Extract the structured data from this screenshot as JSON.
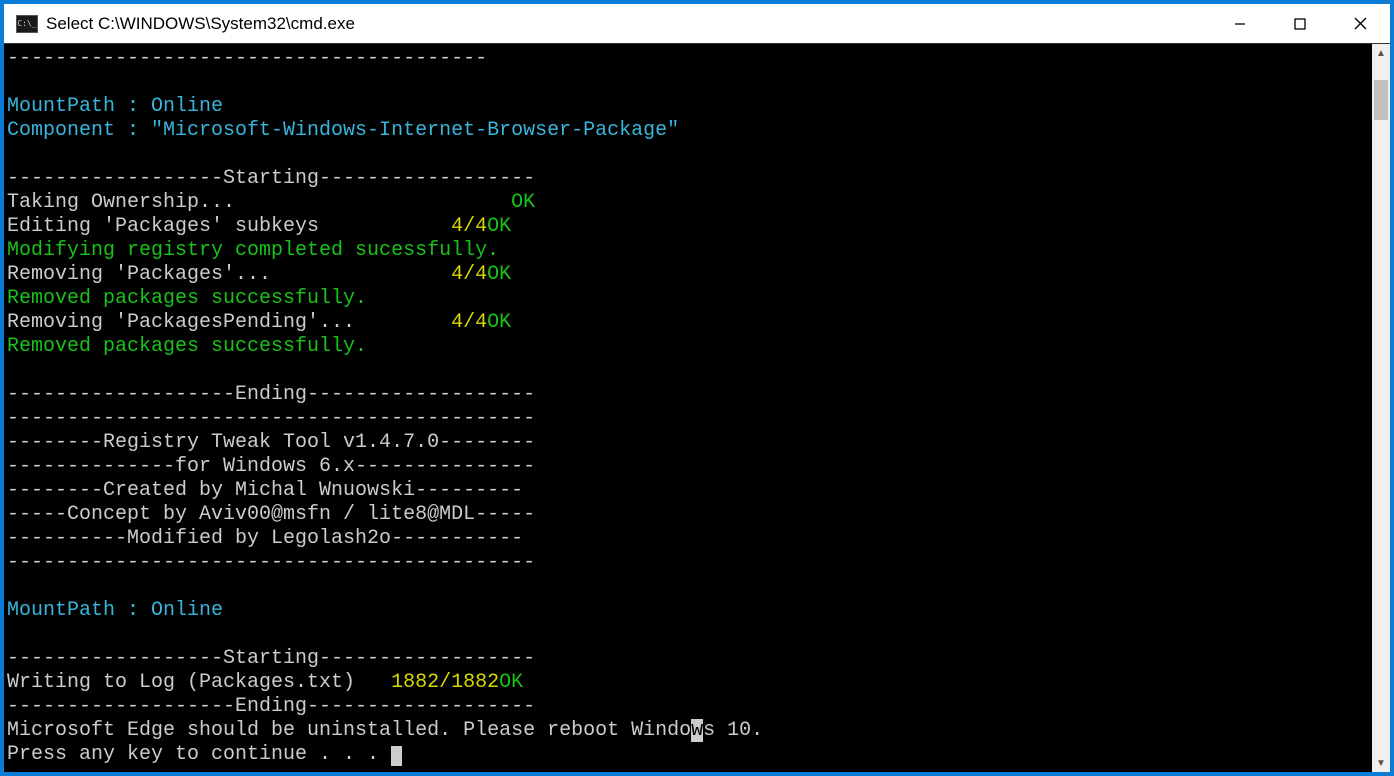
{
  "window": {
    "title": "Select C:\\WINDOWS\\System32\\cmd.exe",
    "icon_label": "C:\\_"
  },
  "lines": [
    [
      {
        "cls": "white",
        "txt": "----------------------------------------"
      }
    ],
    [
      {
        "cls": "white",
        "txt": ""
      }
    ],
    [
      {
        "cls": "blue",
        "txt": "MountPath : Online"
      }
    ],
    [
      {
        "cls": "blue",
        "txt": "Component : \"Microsoft-Windows-Internet-Browser-Package\""
      }
    ],
    [
      {
        "cls": "white",
        "txt": ""
      }
    ],
    [
      {
        "cls": "white",
        "txt": "------------------Starting------------------"
      }
    ],
    [
      {
        "cls": "white",
        "txt": "Taking Ownership...                       "
      },
      {
        "cls": "green",
        "txt": "OK"
      }
    ],
    [
      {
        "cls": "white",
        "txt": "Editing 'Packages' subkeys           "
      },
      {
        "cls": "yellow",
        "txt": "4/4"
      },
      {
        "cls": "green",
        "txt": "OK"
      }
    ],
    [
      {
        "cls": "green",
        "txt": "Modifying registry completed sucessfully."
      }
    ],
    [
      {
        "cls": "white",
        "txt": "Removing 'Packages'...               "
      },
      {
        "cls": "yellow",
        "txt": "4/4"
      },
      {
        "cls": "green",
        "txt": "OK"
      }
    ],
    [
      {
        "cls": "green",
        "txt": "Removed packages successfully."
      }
    ],
    [
      {
        "cls": "white",
        "txt": "Removing 'PackagesPending'...        "
      },
      {
        "cls": "yellow",
        "txt": "4/4"
      },
      {
        "cls": "green",
        "txt": "OK"
      }
    ],
    [
      {
        "cls": "green",
        "txt": "Removed packages successfully."
      }
    ],
    [
      {
        "cls": "white",
        "txt": ""
      }
    ],
    [
      {
        "cls": "white",
        "txt": "-------------------Ending-------------------"
      }
    ],
    [
      {
        "cls": "white",
        "txt": "--------------------------------------------"
      }
    ],
    [
      {
        "cls": "white",
        "txt": "--------Registry Tweak Tool v1.4.7.0--------"
      }
    ],
    [
      {
        "cls": "white",
        "txt": "--------------for Windows 6.x---------------"
      }
    ],
    [
      {
        "cls": "white",
        "txt": "--------Created by Michal Wnuowski---------"
      }
    ],
    [
      {
        "cls": "white",
        "txt": "-----Concept by Aviv00@msfn / lite8@MDL-----"
      }
    ],
    [
      {
        "cls": "white",
        "txt": "----------Modified by Legolash2o-----------"
      }
    ],
    [
      {
        "cls": "white",
        "txt": "--------------------------------------------"
      }
    ],
    [
      {
        "cls": "white",
        "txt": ""
      }
    ],
    [
      {
        "cls": "blue",
        "txt": "MountPath : Online"
      }
    ],
    [
      {
        "cls": "white",
        "txt": ""
      }
    ],
    [
      {
        "cls": "white",
        "txt": "------------------Starting------------------"
      }
    ],
    [
      {
        "cls": "white",
        "txt": "Writing to Log (Packages.txt)   "
      },
      {
        "cls": "yellow",
        "txt": "1882/1882"
      },
      {
        "cls": "green",
        "txt": "OK"
      }
    ],
    [
      {
        "cls": "white",
        "txt": "-------------------Ending-------------------"
      }
    ],
    [
      {
        "cls": "white",
        "txt": "Microsoft Edge should be uninstalled. Please reboot Windo"
      },
      {
        "cls": "sel",
        "txt": "w"
      },
      {
        "cls": "white",
        "txt": "s 10."
      }
    ],
    [
      {
        "cls": "white",
        "txt": "Press any key to continue . . . "
      },
      {
        "cls": "cursor",
        "txt": ""
      }
    ]
  ]
}
